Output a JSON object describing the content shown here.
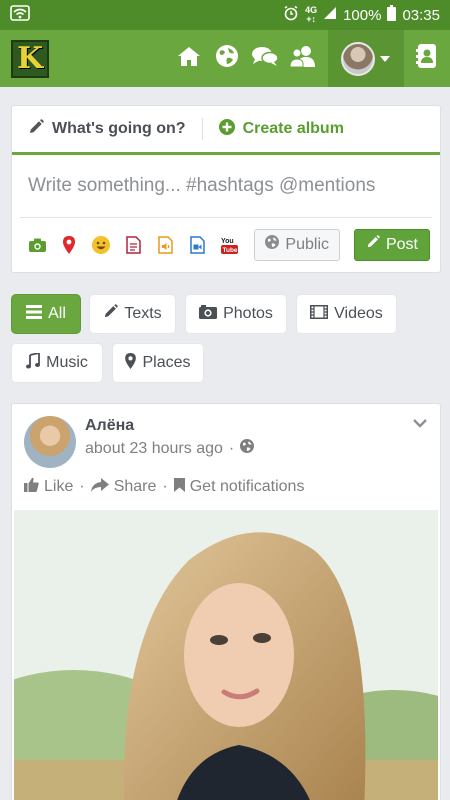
{
  "status_bar": {
    "net_top": "4G",
    "net_bottom": "+↕",
    "battery": "100%",
    "time": "03:35"
  },
  "top_nav": {
    "logo_letter": "K",
    "icons": [
      "home-icon",
      "globe-icon",
      "chat-icon",
      "users-icon"
    ],
    "avatar_caret": "▾"
  },
  "composer": {
    "tab_status": "What's going on?",
    "tab_album": "Create album",
    "placeholder": "Write something... #hashtags @mentions",
    "attach_icons": [
      "camera-icon",
      "location-pin-icon",
      "emoji-icon",
      "document-icon",
      "audio-file-icon",
      "video-file-icon",
      "youtube-icon"
    ],
    "privacy": "Public",
    "post_button": "Post"
  },
  "filters": [
    {
      "label": "All",
      "icon": "list-icon",
      "active": true
    },
    {
      "label": "Texts",
      "icon": "pencil-icon",
      "active": false
    },
    {
      "label": "Photos",
      "icon": "photo-icon",
      "active": false
    },
    {
      "label": "Videos",
      "icon": "film-icon",
      "active": false
    },
    {
      "label": "Music",
      "icon": "music-icon",
      "active": false
    },
    {
      "label": "Places",
      "icon": "map-marker-icon",
      "active": false
    }
  ],
  "post": {
    "author": "Алёна",
    "time": "about 23 hours ago",
    "separator": "·",
    "actions": {
      "like": "Like",
      "share": "Share",
      "notify": "Get notifications"
    }
  },
  "colors": {
    "status_bar": "#4e8c2a",
    "top_nav": "#6aa73e",
    "accent_green": "#5fa33a",
    "background": "#e9ebee"
  }
}
